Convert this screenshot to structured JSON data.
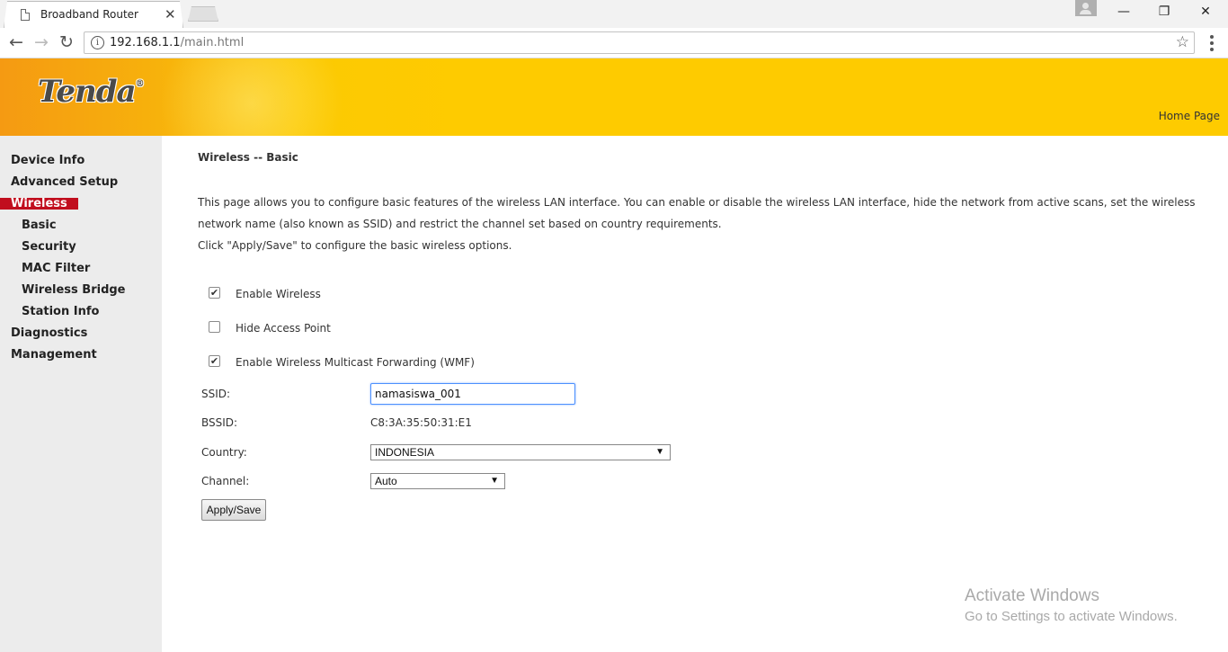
{
  "browser": {
    "tab_title": "Broadband Router",
    "tab_close": "✕",
    "url_host": "192.168.1.1",
    "url_path": "/main.html",
    "back": "←",
    "forward": "→",
    "reload": "↻",
    "minimize": "—",
    "restore": "❐",
    "close": "✕"
  },
  "banner": {
    "logo": "Tenda",
    "logo_mark": "®",
    "home_link": "Home Page"
  },
  "sidebar": {
    "items": [
      {
        "label": "Device Info"
      },
      {
        "label": "Advanced Setup"
      },
      {
        "label": "Wireless"
      },
      {
        "label": "Basic"
      },
      {
        "label": "Security"
      },
      {
        "label": "MAC Filter"
      },
      {
        "label": "Wireless Bridge"
      },
      {
        "label": "Station Info"
      },
      {
        "label": "Diagnostics"
      },
      {
        "label": "Management"
      }
    ],
    "active_color": "#c10e1e"
  },
  "content": {
    "heading": "Wireless -- Basic",
    "description_1": "This page allows you to configure basic features of the wireless LAN interface. You can enable or disable the wireless LAN interface, hide the network from active scans, set the wireless network name (also known as SSID) and restrict the channel set based on country requirements.",
    "description_2": "Click \"Apply/Save\" to configure the basic wireless options.",
    "checkboxes": [
      {
        "label": "Enable Wireless",
        "checked": true,
        "mark": "✔"
      },
      {
        "label": "Hide Access Point",
        "checked": false,
        "mark": ""
      },
      {
        "label": "Enable Wireless Multicast Forwarding (WMF)",
        "checked": true,
        "mark": "✔"
      }
    ],
    "ssid_label": "SSID:",
    "ssid_value": "namasiswa_001",
    "bssid_label": "BSSID:",
    "bssid_value": "C8:3A:35:50:31:E1",
    "country_label": "Country:",
    "country_value": "INDONESIA",
    "channel_label": "Channel:",
    "channel_value": "Auto",
    "apply_label": "Apply/Save"
  },
  "watermark": {
    "title": "Activate Windows",
    "subtitle": "Go to Settings to activate Windows."
  }
}
